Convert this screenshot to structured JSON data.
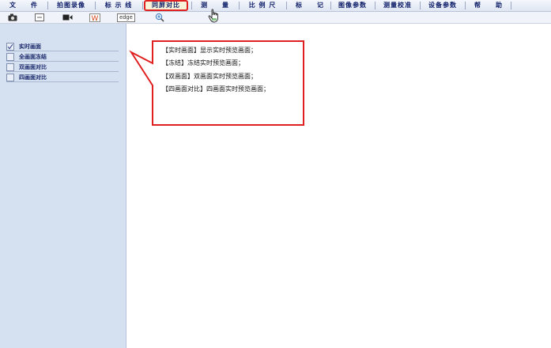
{
  "menu": {
    "items": [
      {
        "label": "文　　件"
      },
      {
        "label": "拍图录像"
      },
      {
        "label": "标 示 线"
      },
      {
        "label": "同屏对比"
      },
      {
        "label": "测　　量"
      },
      {
        "label": "比 例 尺"
      },
      {
        "label": "标　　记"
      },
      {
        "label": "图像参数"
      },
      {
        "label": "测量校准"
      },
      {
        "label": "设备参数"
      },
      {
        "label": "帮　　助"
      }
    ],
    "active_item": "同屏对比"
  },
  "toolbar": {
    "icons": [
      "camera-icon",
      "snapshot-box-icon",
      "video-icon",
      "watermark-w-icon",
      "edge-icon",
      "zoom-in-icon"
    ],
    "edge_label": "edge",
    "w_label": "W"
  },
  "panel": {
    "items": [
      {
        "label": "实时画面",
        "checked": true
      },
      {
        "label": "全画面冻结",
        "checked": false
      },
      {
        "label": "双画面对比",
        "checked": false
      },
      {
        "label": "四画面对比",
        "checked": false
      }
    ]
  },
  "callout": {
    "lines": [
      "【实时画面】显示实时预览画面；",
      "【冻结】冻结实时预览画面；",
      "【双画面】双画面实时预览画面；",
      "【四画面对比】四画面实时预览画面；"
    ],
    "border_color": "#e02020"
  },
  "colors": {
    "panel_bg": "#d5e0f1",
    "menu_text": "#10206a",
    "highlight": "#e02020"
  }
}
